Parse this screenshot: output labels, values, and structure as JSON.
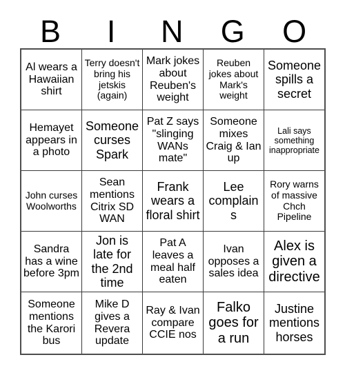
{
  "card": {
    "title": "BINGO",
    "header_letters": [
      "B",
      "I",
      "N",
      "G",
      "O"
    ],
    "columns": 5,
    "rows": 5,
    "colors": {
      "background": "#ffffff",
      "text": "#000000",
      "grid_line": "#3a3a3a",
      "grid_border": "#4d4d4d"
    },
    "cells": [
      {
        "text": "Al wears a Hawaiian shirt",
        "size": "fs-md"
      },
      {
        "text": "Terry doesn't bring his jetskis (again)",
        "size": "fs-sm"
      },
      {
        "text": "Mark jokes about Reuben's weight",
        "size": "fs-md"
      },
      {
        "text": "Reuben jokes about Mark's weight",
        "size": "fs-sm"
      },
      {
        "text": "Someone spills a secret",
        "size": "fs-lg"
      },
      {
        "text": "Hemayet appears in a photo",
        "size": "fs-md"
      },
      {
        "text": "Someone curses Spark",
        "size": "fs-lg"
      },
      {
        "text": "Pat Z says \"slinging WANs mate\"",
        "size": "fs-md"
      },
      {
        "text": "Someone mixes Craig & Ian up",
        "size": "fs-md"
      },
      {
        "text": "Lali says something inappropriate",
        "size": "fs-xs"
      },
      {
        "text": "John curses Woolworths",
        "size": "fs-sm"
      },
      {
        "text": "Sean mentions Citrix SD WAN",
        "size": "fs-md"
      },
      {
        "text": "Frank wears a floral shirt",
        "size": "fs-lg"
      },
      {
        "text": "Lee complains",
        "size": "fs-lg"
      },
      {
        "text": "Rory warns of massive Chch Pipeline",
        "size": "fs-sm"
      },
      {
        "text": "Sandra has a wine before 3pm",
        "size": "fs-md"
      },
      {
        "text": "Jon is late for the 2nd time",
        "size": "fs-lg"
      },
      {
        "text": "Pat A leaves a meal half eaten",
        "size": "fs-md"
      },
      {
        "text": "Ivan opposes a sales idea",
        "size": "fs-md"
      },
      {
        "text": "Alex is given a directive",
        "size": "fs-xl"
      },
      {
        "text": "Someone mentions the Karori bus",
        "size": "fs-md"
      },
      {
        "text": "Mike D gives a Revera update",
        "size": "fs-md"
      },
      {
        "text": "Ray & Ivan compare CCIE nos",
        "size": "fs-md"
      },
      {
        "text": "Falko goes for a run",
        "size": "fs-xl"
      },
      {
        "text": "Justine mentions horses",
        "size": "fs-lg"
      }
    ]
  }
}
